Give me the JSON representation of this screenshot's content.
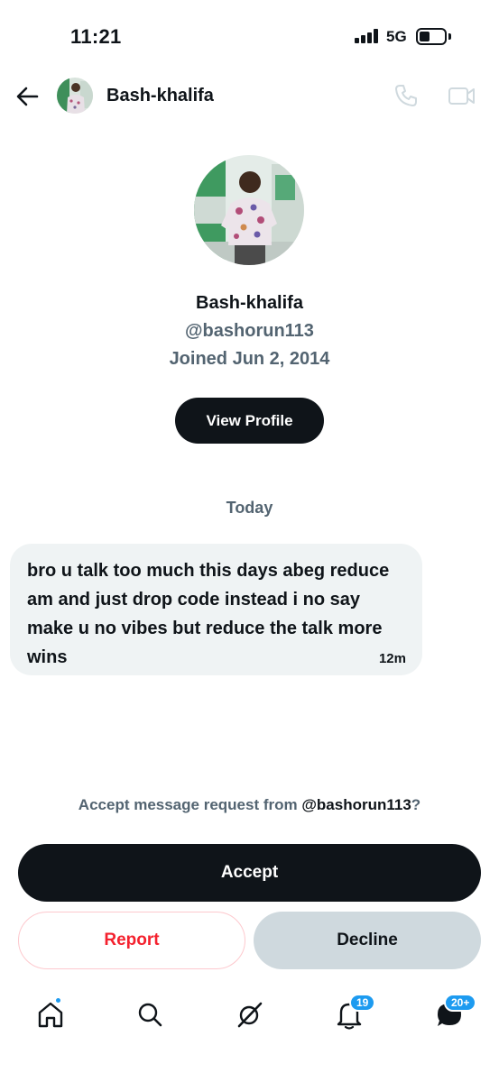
{
  "status_bar": {
    "time": "11:21",
    "network": "5G"
  },
  "header": {
    "name": "Bash-khalifa"
  },
  "profile": {
    "name": "Bash-khalifa",
    "handle": "@bashorun113",
    "joined": "Joined Jun 2, 2014",
    "view_profile_label": "View Profile"
  },
  "conversation": {
    "date_label": "Today",
    "messages": [
      {
        "text": "bro u talk too much this days abeg reduce am and just drop code instead i no say make u no vibes but reduce the talk more wins",
        "time": "12m"
      }
    ]
  },
  "request": {
    "prompt_prefix": "Accept message request from ",
    "prompt_handle": "@bashorun113",
    "prompt_suffix": "?",
    "accept_label": "Accept",
    "report_label": "Report",
    "decline_label": "Decline"
  },
  "nav": {
    "notifications_badge": "19",
    "messages_badge": "20+"
  },
  "colors": {
    "primary_text": "#0f1419",
    "secondary_text": "#536471",
    "accent_blue": "#1d9bf0",
    "danger_red": "#f4212e",
    "bubble_bg": "#eff3f4",
    "decline_bg": "#cfd9de"
  },
  "icons": [
    "back-arrow-icon",
    "phone-icon",
    "video-camera-icon",
    "home-icon",
    "search-icon",
    "grok-icon",
    "bell-icon",
    "messages-icon"
  ]
}
